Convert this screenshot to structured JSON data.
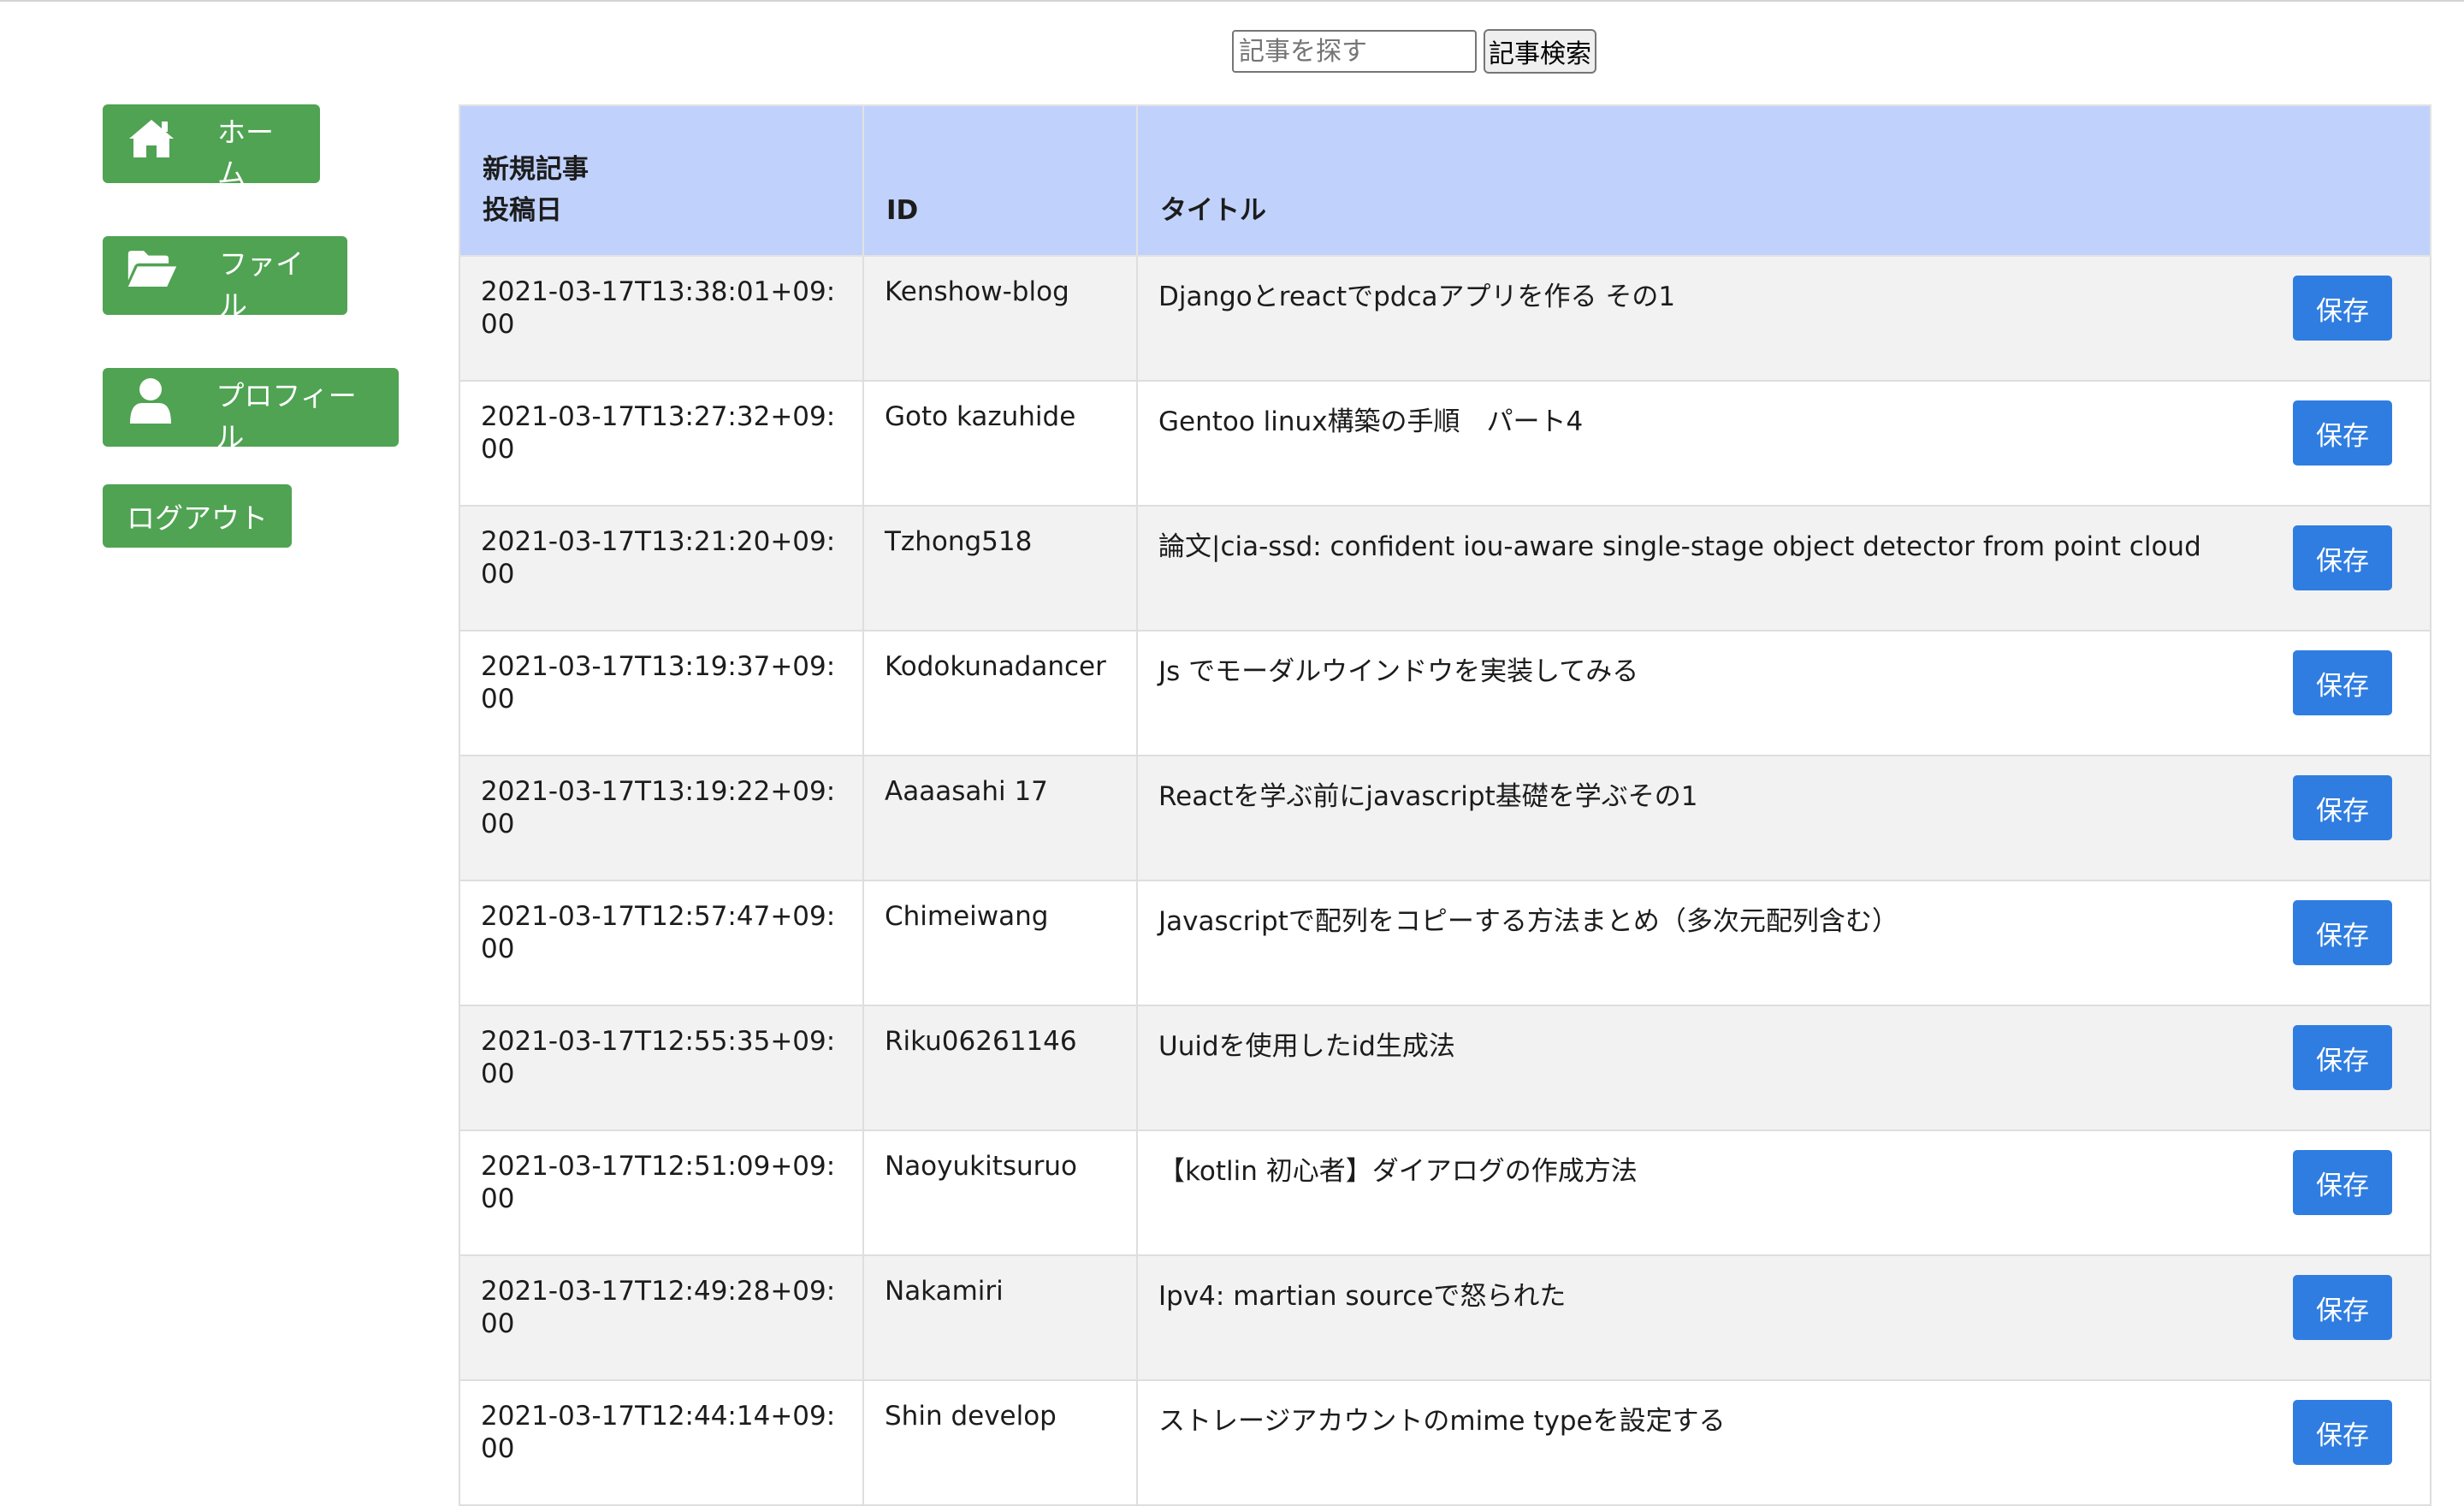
{
  "search": {
    "placeholder": "記事を探す",
    "button_label": "記事検索"
  },
  "sidebar": {
    "items": [
      {
        "label": "ホーム",
        "icon": "home-icon"
      },
      {
        "label": "ファイル",
        "icon": "folder-open-icon"
      },
      {
        "label": "プロフィール",
        "icon": "user-icon"
      }
    ],
    "logout_label": "ログアウト"
  },
  "colors": {
    "nav_green": "#4fa352",
    "header_blue": "#c0d2fb",
    "save_blue": "#2f7de1"
  },
  "table": {
    "headers": {
      "col1_line1": "新規記事",
      "col1_line2": "投稿日",
      "col2": "ID",
      "col3": "タイトル"
    },
    "save_label": "保存",
    "rows": [
      {
        "date": "2021-03-17T13:38:01+09:00",
        "id": "Kenshow-blog",
        "title": "Djangoとreactでpdcaアプリを作る その1"
      },
      {
        "date": "2021-03-17T13:27:32+09:00",
        "id": "Goto kazuhide",
        "title": "Gentoo linux構築の手順　パート4"
      },
      {
        "date": "2021-03-17T13:21:20+09:00",
        "id": "Tzhong518",
        "title": "論文|cia-ssd: confident iou-aware single-stage object detector from point cloud"
      },
      {
        "date": "2021-03-17T13:19:37+09:00",
        "id": "Kodokunadancer",
        "title": "Js でモーダルウインドウを実装してみる"
      },
      {
        "date": "2021-03-17T13:19:22+09:00",
        "id": "Aaaasahi 17",
        "title": "Reactを学ぶ前にjavascript基礎を学ぶその1"
      },
      {
        "date": "2021-03-17T12:57:47+09:00",
        "id": "Chimeiwang",
        "title": "Javascriptで配列をコピーする方法まとめ（多次元配列含む）"
      },
      {
        "date": "2021-03-17T12:55:35+09:00",
        "id": "Riku06261146",
        "title": "Uuidを使用したid生成法"
      },
      {
        "date": "2021-03-17T12:51:09+09:00",
        "id": "Naoyukitsuruo",
        "title": "【kotlin 初心者】ダイアログの作成方法"
      },
      {
        "date": "2021-03-17T12:49:28+09:00",
        "id": "Nakamiri",
        "title": "Ipv4: martian sourceで怒られた"
      },
      {
        "date": "2021-03-17T12:44:14+09:00",
        "id": "Shin develop",
        "title": "ストレージアカウントのmime typeを設定する"
      }
    ]
  }
}
